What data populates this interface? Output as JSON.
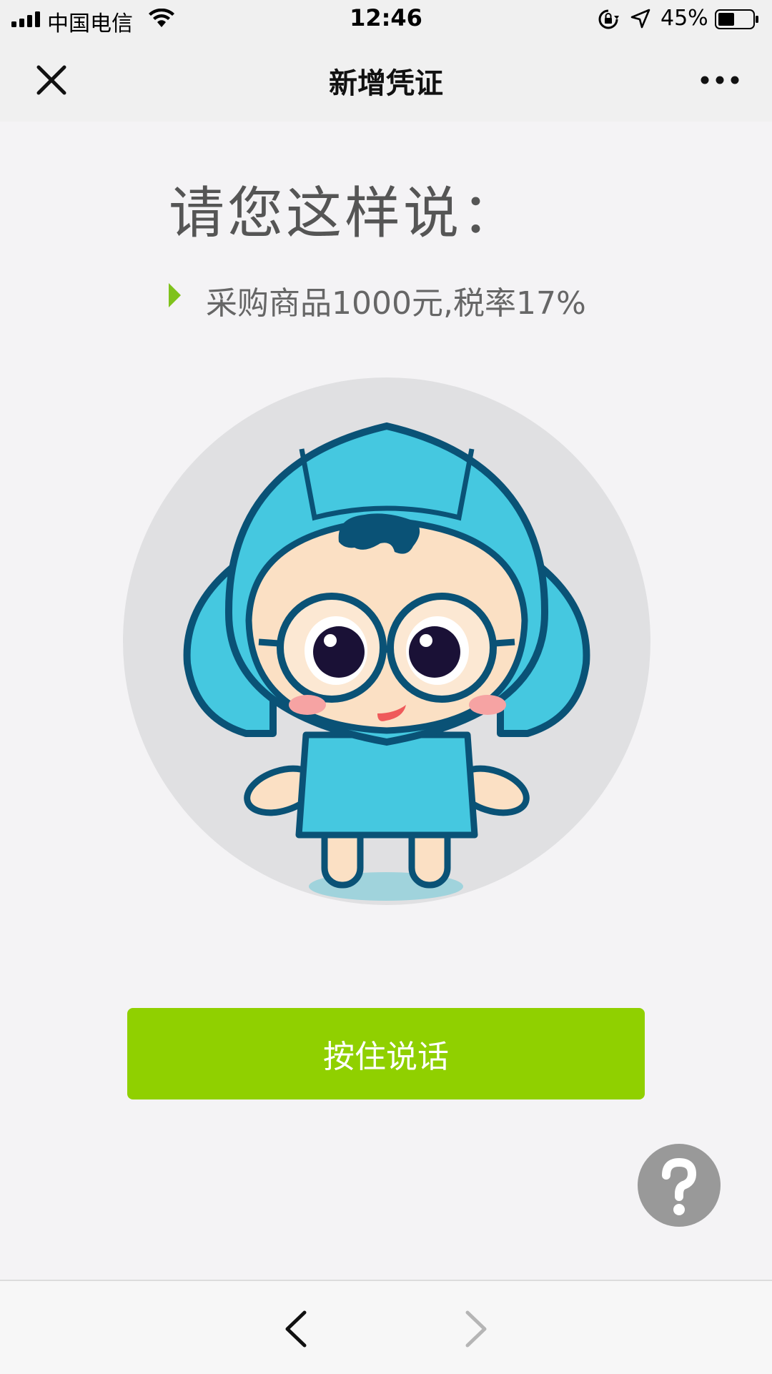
{
  "status_bar": {
    "carrier": "中国电信",
    "time": "12:46",
    "battery": "45%",
    "icons": [
      "signal-icon",
      "wifi-icon",
      "rotation-lock-icon",
      "location-icon",
      "battery-icon"
    ]
  },
  "nav": {
    "title": "新增凭证",
    "close_icon": "close-icon",
    "more_icon": "more-icon"
  },
  "main": {
    "prompt_title": "请您这样说：",
    "hint_text": "采购商品1000元,税率17%",
    "talk_button_label": "按住说话",
    "help_icon": "help-icon",
    "avatar": "robot-mascot"
  },
  "toolbar": {
    "back_icon": "back-arrow-icon",
    "forward_icon": "forward-arrow-icon"
  },
  "colors": {
    "accent": "#90d000",
    "hint_arrow": "#7fc21c",
    "page_bg": "#f4f3f5",
    "help_bg": "#999999",
    "mascot": "#45c8e0"
  }
}
